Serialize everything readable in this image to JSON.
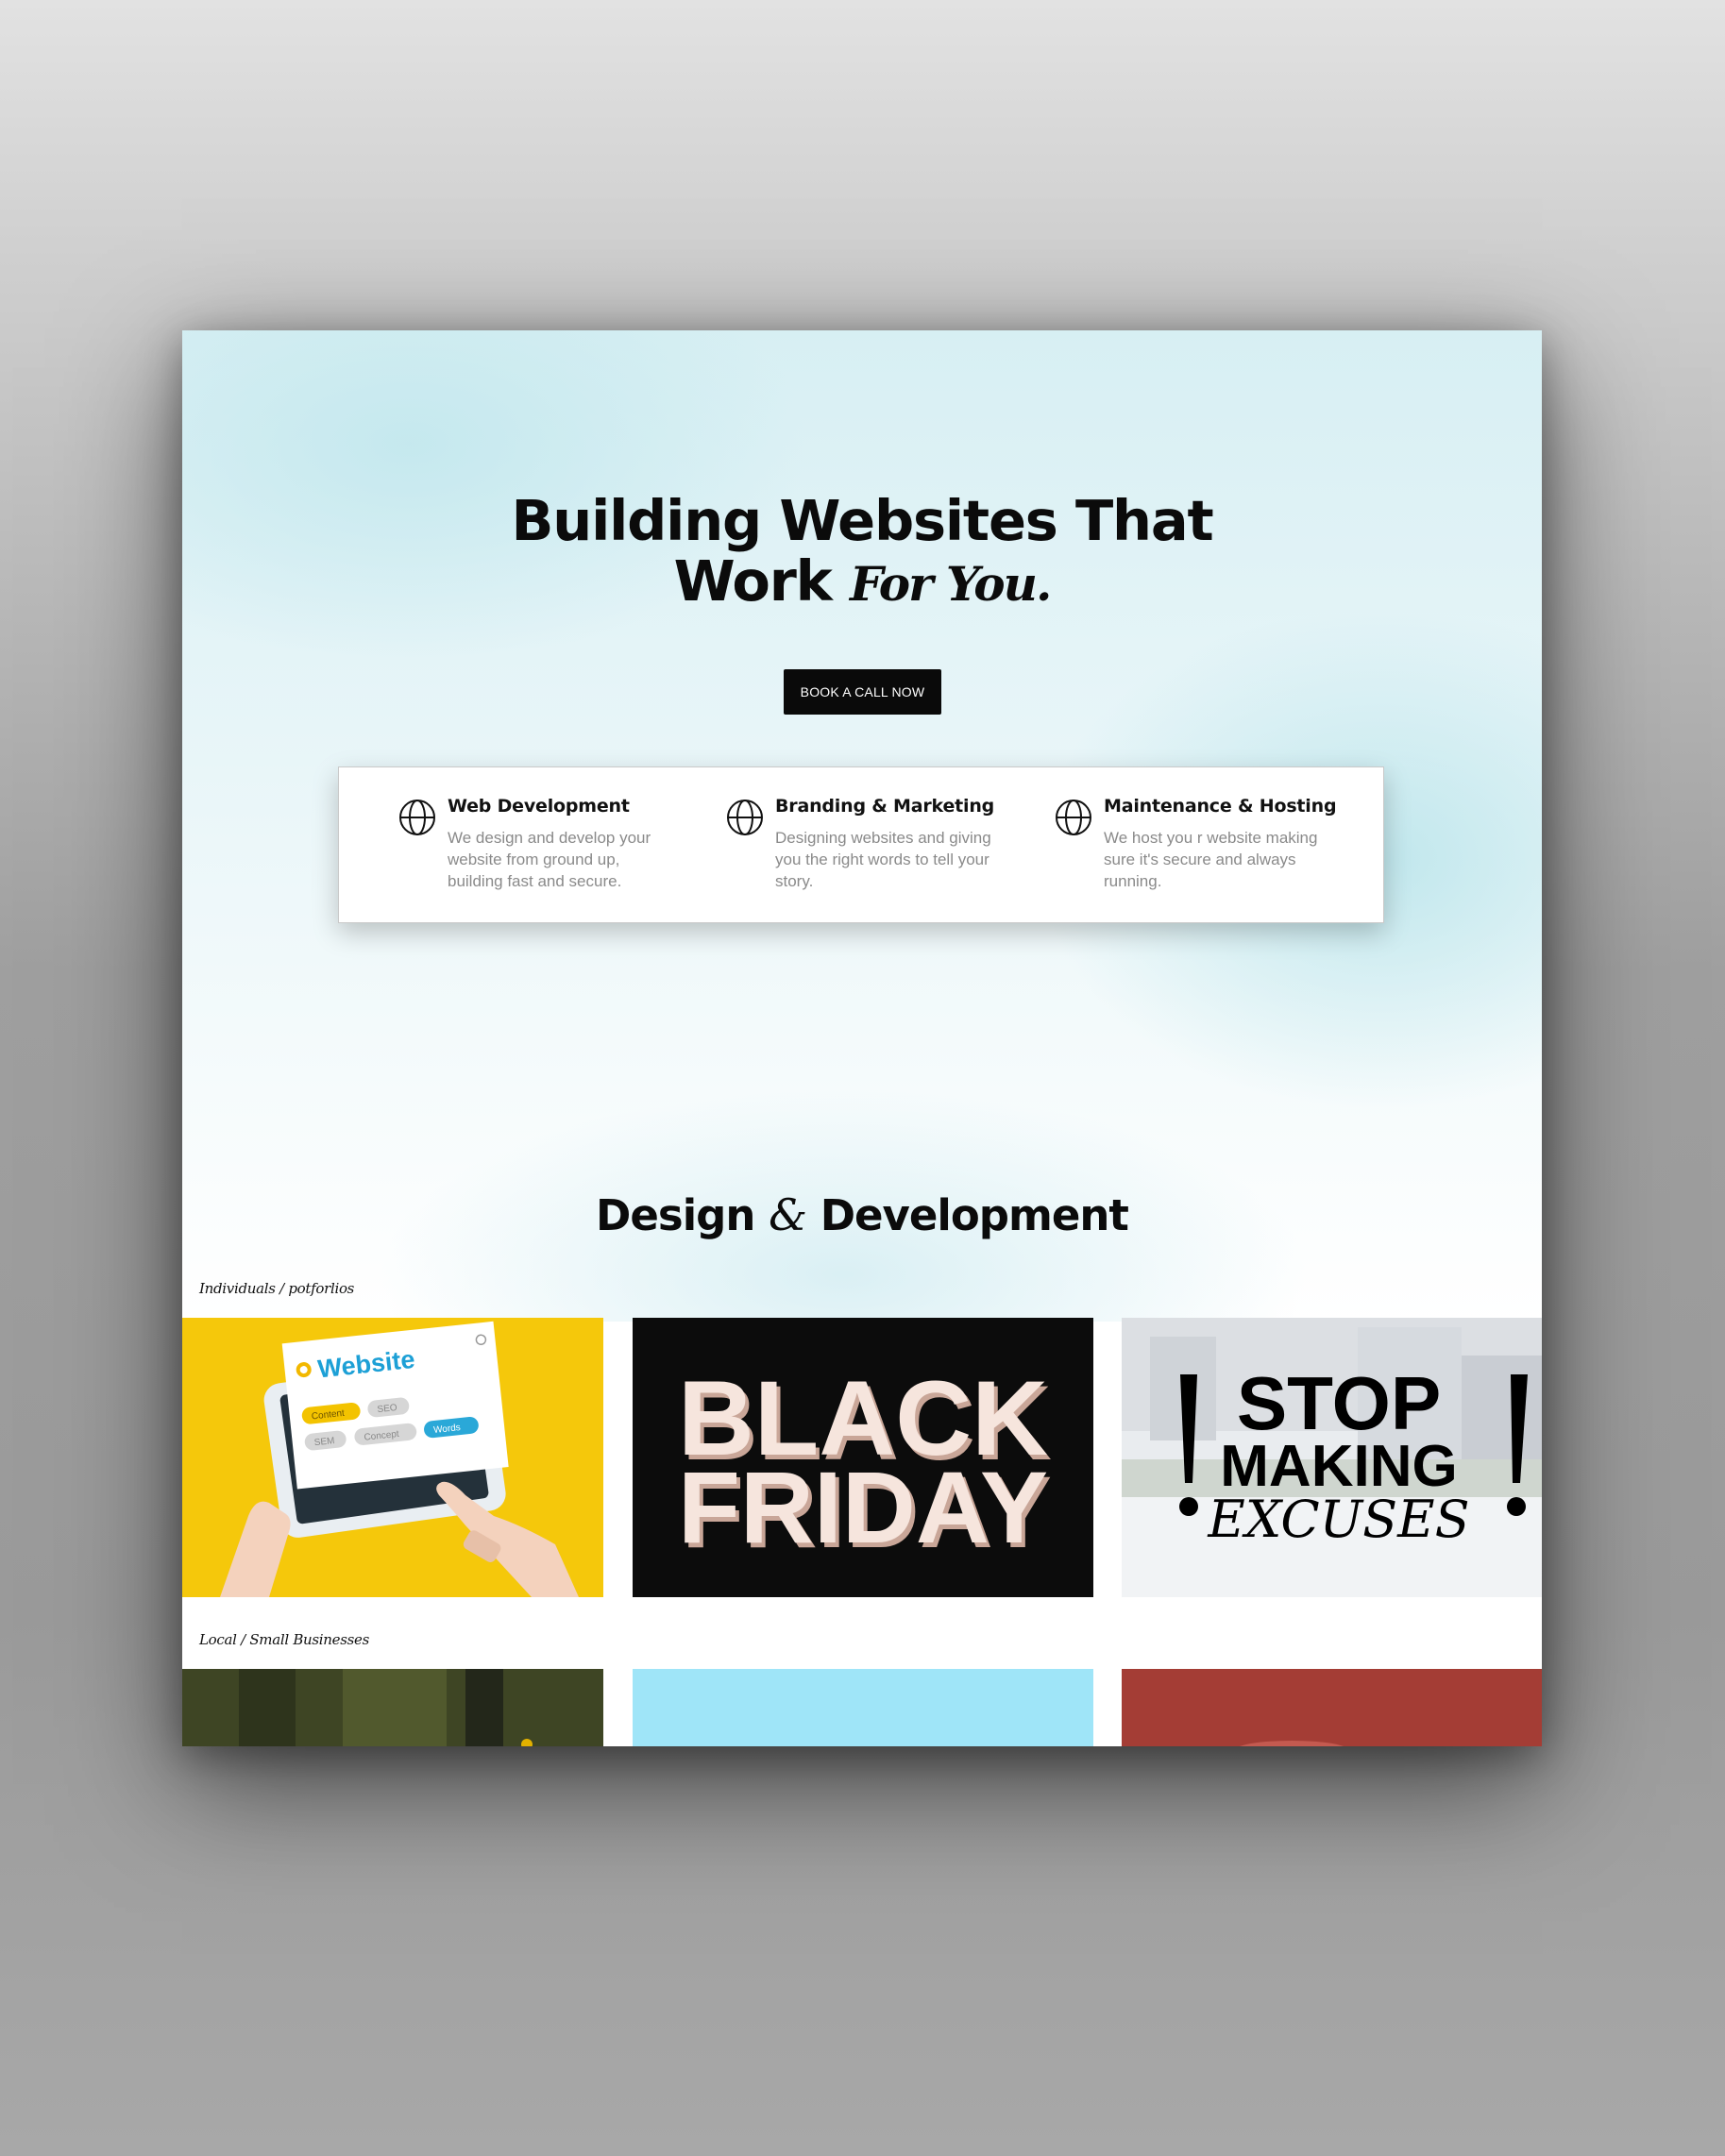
{
  "hero": {
    "title_line1": "Building Websites That",
    "title_work": "Work",
    "title_script": "For You.",
    "cta_label": "BOOK A CALL NOW"
  },
  "services": [
    {
      "icon": "globe-icon",
      "title": "Web Development",
      "description": "We design and develop your website from ground up, building fast and secure."
    },
    {
      "icon": "globe-icon",
      "title": "Branding & Marketing",
      "description": "Designing websites and giving you the right words to tell your story."
    },
    {
      "icon": "globe-icon",
      "title": "Maintenance & Hosting",
      "description": "We host you r website making sure it's secure and always running."
    }
  ],
  "section": {
    "title_part1": "Design",
    "title_amp": "&",
    "title_part2": "Development"
  },
  "categories": [
    {
      "label": "Individuals / potforlios"
    },
    {
      "label": "Local / Small Businesses"
    }
  ],
  "portfolio_tiles": {
    "website": {
      "heading": "Website",
      "tags": [
        "Content",
        "SEO",
        "SEM",
        "Concept",
        "Words"
      ]
    },
    "black_friday": {
      "line1": "BLACK",
      "line2": "FRIDAY"
    },
    "stop_making_excuses": {
      "line1": "STOP",
      "line2": "MAKING",
      "line3": "EXCUSES"
    }
  },
  "colors": {
    "hero_bg": "#d7eff3",
    "cta_bg": "#0a0a0a",
    "text_dark": "#0b0b0b",
    "text_muted": "#8a8a8a",
    "accent_yellow": "#f3c500",
    "accent_blue": "#2aa8d8"
  }
}
